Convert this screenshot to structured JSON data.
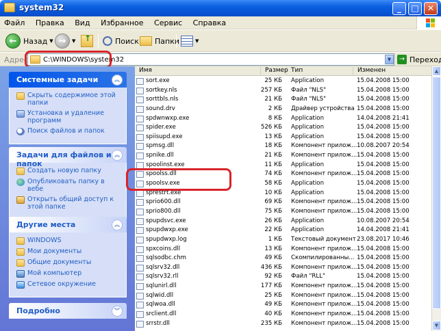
{
  "window": {
    "title": "system32"
  },
  "menu": [
    "Файл",
    "Правка",
    "Вид",
    "Избранное",
    "Сервис",
    "Справка"
  ],
  "toolbar": {
    "back": "Назад",
    "search": "Поиск",
    "folders": "Папки"
  },
  "address": {
    "label": "Адрес",
    "path": "C:\\WINDOWS\\system32",
    "go": "Переход"
  },
  "panels": {
    "system": {
      "title": "Системные задачи",
      "links": [
        "Скрыть содержимое этой папки",
        "Установка и удаление программ",
        "Поиск файлов и папок"
      ],
      "icons": [
        "folder-icon",
        "control-panel-icon",
        "search-icon"
      ]
    },
    "files": {
      "title": "Задачи для файлов и папок",
      "links": [
        "Создать новую папку",
        "Опубликовать папку в вебе",
        "Открыть общий доступ к этой папке"
      ],
      "icons": [
        "new-folder-icon",
        "globe-icon",
        "share-icon"
      ]
    },
    "places": {
      "title": "Другие места",
      "links": [
        "WINDOWS",
        "Мои документы",
        "Общие документы",
        "Мой компьютер",
        "Сетевое окружение"
      ],
      "icons": [
        "folder-icon",
        "folder-icon",
        "folder-icon",
        "computer-icon",
        "network-icon"
      ]
    },
    "details": {
      "title": "Подробно"
    }
  },
  "columns": {
    "name": "Имя",
    "size": "Размер",
    "type": "Тип",
    "modified": "Изменен"
  },
  "files": [
    {
      "name": "sort.exe",
      "size": "25 КБ",
      "type": "Application",
      "modified": "15.04.2008 15:00"
    },
    {
      "name": "sortkey.nls",
      "size": "257 КБ",
      "type": "Файл \"NLS\"",
      "modified": "15.04.2008 15:00"
    },
    {
      "name": "sorttbls.nls",
      "size": "21 КБ",
      "type": "Файл \"NLS\"",
      "modified": "15.04.2008 15:00"
    },
    {
      "name": "sound.drv",
      "size": "2 КБ",
      "type": "Драйвер устройства",
      "modified": "15.04.2008 15:00"
    },
    {
      "name": "spdwnwxp.exe",
      "size": "8 КБ",
      "type": "Application",
      "modified": "14.04.2008 21:41"
    },
    {
      "name": "spider.exe",
      "size": "526 КБ",
      "type": "Application",
      "modified": "15.04.2008 15:00"
    },
    {
      "name": "spiisupd.exe",
      "size": "13 КБ",
      "type": "Application",
      "modified": "15.04.2008 15:00"
    },
    {
      "name": "spmsg.dll",
      "size": "18 КБ",
      "type": "Компонент прилож...",
      "modified": "10.08.2007 20:54"
    },
    {
      "name": "spnike.dll",
      "size": "21 КБ",
      "type": "Компонент прилож...",
      "modified": "15.04.2008 15:00"
    },
    {
      "name": "spoolinst.exe",
      "size": "11 КБ",
      "type": "Application",
      "modified": "15.04.2008 15:00"
    },
    {
      "name": "spoolss.dll",
      "size": "74 КБ",
      "type": "Компонент прилож...",
      "modified": "15.04.2008 15:00"
    },
    {
      "name": "spoolsv.exe",
      "size": "58 КБ",
      "type": "Application",
      "modified": "15.04.2008 15:00"
    },
    {
      "name": "sprestrt.exe",
      "size": "10 КБ",
      "type": "Application",
      "modified": "15.04.2008 15:00"
    },
    {
      "name": "sprio600.dll",
      "size": "69 КБ",
      "type": "Компонент прилож...",
      "modified": "15.04.2008 15:00"
    },
    {
      "name": "sprio800.dll",
      "size": "75 КБ",
      "type": "Компонент прилож...",
      "modified": "15.04.2008 15:00"
    },
    {
      "name": "spupdsvc.exe",
      "size": "26 КБ",
      "type": "Application",
      "modified": "10.08.2007 20:54"
    },
    {
      "name": "spupdwxp.exe",
      "size": "22 КБ",
      "type": "Application",
      "modified": "14.04.2008 21:41"
    },
    {
      "name": "spupdwxp.log",
      "size": "1 КБ",
      "type": "Текстовый документ",
      "modified": "23.08.2017 10:46"
    },
    {
      "name": "spxcoins.dll",
      "size": "13 КБ",
      "type": "Компонент прилож...",
      "modified": "15.04.2008 15:00"
    },
    {
      "name": "sqlsodbc.chm",
      "size": "49 КБ",
      "type": "Скомпилированны...",
      "modified": "15.04.2008 15:00"
    },
    {
      "name": "sqlsrv32.dll",
      "size": "436 КБ",
      "type": "Компонент прилож...",
      "modified": "15.04.2008 15:00"
    },
    {
      "name": "sqlsrv32.rll",
      "size": "92 КБ",
      "type": "Файл \"RLL\"",
      "modified": "15.04.2008 15:00"
    },
    {
      "name": "sqlunirl.dll",
      "size": "177 КБ",
      "type": "Компонент прилож...",
      "modified": "15.04.2008 15:00"
    },
    {
      "name": "sqlwid.dll",
      "size": "25 КБ",
      "type": "Компонент прилож...",
      "modified": "15.04.2008 15:00"
    },
    {
      "name": "sqlwoa.dll",
      "size": "49 КБ",
      "type": "Компонент прилож...",
      "modified": "15.04.2008 15:00"
    },
    {
      "name": "srclient.dll",
      "size": "40 КБ",
      "type": "Компонент прилож...",
      "modified": "15.04.2008 15:00"
    },
    {
      "name": "srrstr.dll",
      "size": "235 КБ",
      "type": "Компонент прилож...",
      "modified": "15.04.2008 15:00"
    }
  ]
}
